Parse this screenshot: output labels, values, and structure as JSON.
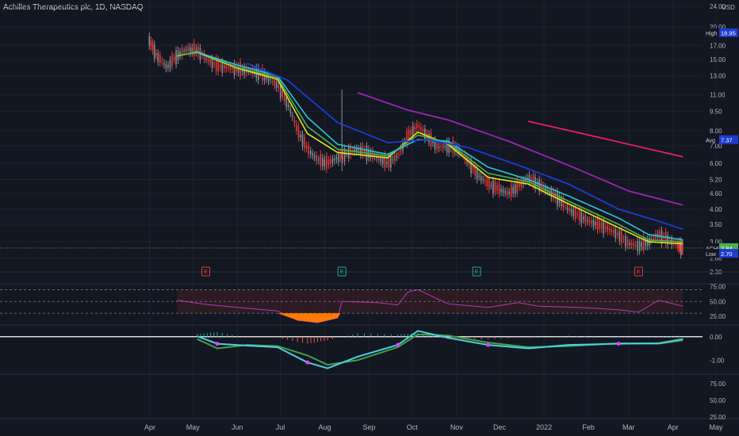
{
  "header": {
    "title": "Achilles Therapeutics plc, 1D, NASDAQ"
  },
  "colors": {
    "background": "#131722",
    "grid": "#1e222d",
    "up_candle": "#8a8d96",
    "down_candle": "#e53935",
    "ema_yellow": "#e6e619",
    "ema_green": "#4caf50",
    "ema_cyan": "#26c6da",
    "ema_blue": "#1e3cd0",
    "ema_purple": "#9c27b0",
    "ema_pink": "#e91e63",
    "rsi_line": "#b03ab5",
    "macd_line": "#4dd0e1",
    "signal_line": "#43a047"
  },
  "chart_data": {
    "type": "candlestick",
    "title": "Achilles Therapeutics plc, 1D, NASDAQ",
    "currency": "USD",
    "scale": "log",
    "grid": true,
    "x_ticks": [
      "Apr",
      "May",
      "Jun",
      "Jul",
      "Aug",
      "Sep",
      "Oct",
      "Nov",
      "Dec",
      "2022",
      "Feb",
      "Mar",
      "Apr",
      "May"
    ],
    "y_ticks": [
      "24.00",
      "20.00",
      "17.00",
      "15.00",
      "13.00",
      "11.00",
      "9.50",
      "8.00",
      "7.00",
      "6.00",
      "5.20",
      "4.60",
      "4.00",
      "3.50",
      "3.00",
      "2.60",
      "2.30"
    ],
    "ylim": [
      2.3,
      24.0
    ],
    "price_closes": [
      {
        "date": "2021-03-31",
        "close": 18.0
      },
      {
        "date": "2021-04-06",
        "close": 15.5
      },
      {
        "date": "2021-04-13",
        "close": 14.0
      },
      {
        "date": "2021-04-20",
        "close": 15.6
      },
      {
        "date": "2021-04-27",
        "close": 16.4
      },
      {
        "date": "2021-05-04",
        "close": 16.3
      },
      {
        "date": "2021-05-11",
        "close": 15.0
      },
      {
        "date": "2021-05-18",
        "close": 14.2
      },
      {
        "date": "2021-05-25",
        "close": 14.0
      },
      {
        "date": "2021-06-01",
        "close": 13.8
      },
      {
        "date": "2021-06-08",
        "close": 13.6
      },
      {
        "date": "2021-06-15",
        "close": 13.4
      },
      {
        "date": "2021-06-22",
        "close": 12.8
      },
      {
        "date": "2021-06-29",
        "close": 12.0
      },
      {
        "date": "2021-07-06",
        "close": 10.2
      },
      {
        "date": "2021-07-13",
        "close": 8.0
      },
      {
        "date": "2021-07-20",
        "close": 6.8
      },
      {
        "date": "2021-07-27",
        "close": 6.2
      },
      {
        "date": "2021-08-03",
        "close": 6.0
      },
      {
        "date": "2021-08-10",
        "close": 6.3
      },
      {
        "date": "2021-08-17",
        "close": 6.6
      },
      {
        "date": "2021-08-24",
        "close": 6.8
      },
      {
        "date": "2021-08-31",
        "close": 6.6
      },
      {
        "date": "2021-09-07",
        "close": 6.3
      },
      {
        "date": "2021-09-14",
        "close": 6.0
      },
      {
        "date": "2021-09-21",
        "close": 6.4
      },
      {
        "date": "2021-09-28",
        "close": 7.6
      },
      {
        "date": "2021-10-05",
        "close": 8.4
      },
      {
        "date": "2021-10-12",
        "close": 7.6
      },
      {
        "date": "2021-10-19",
        "close": 6.9
      },
      {
        "date": "2021-10-26",
        "close": 7.0
      },
      {
        "date": "2021-11-02",
        "close": 6.8
      },
      {
        "date": "2021-11-09",
        "close": 6.1
      },
      {
        "date": "2021-11-16",
        "close": 5.4
      },
      {
        "date": "2021-11-23",
        "close": 5.0
      },
      {
        "date": "2021-11-30",
        "close": 4.8
      },
      {
        "date": "2021-12-07",
        "close": 4.6
      },
      {
        "date": "2021-12-14",
        "close": 4.9
      },
      {
        "date": "2021-12-21",
        "close": 5.3
      },
      {
        "date": "2021-12-28",
        "close": 5.0
      },
      {
        "date": "2022-01-04",
        "close": 4.7
      },
      {
        "date": "2022-01-11",
        "close": 4.4
      },
      {
        "date": "2022-01-18",
        "close": 4.0
      },
      {
        "date": "2022-01-25",
        "close": 3.8
      },
      {
        "date": "2022-02-01",
        "close": 3.6
      },
      {
        "date": "2022-02-08",
        "close": 3.5
      },
      {
        "date": "2022-02-15",
        "close": 3.35
      },
      {
        "date": "2022-02-22",
        "close": 3.2
      },
      {
        "date": "2022-03-01",
        "close": 2.95
      },
      {
        "date": "2022-03-08",
        "close": 2.9
      },
      {
        "date": "2022-03-15",
        "close": 3.0
      },
      {
        "date": "2022-03-22",
        "close": 3.2
      },
      {
        "date": "2022-03-29",
        "close": 3.05
      },
      {
        "date": "2022-04-05",
        "close": 2.9
      },
      {
        "date": "2022-04-08",
        "close": 2.84
      }
    ],
    "moving_averages": [
      {
        "color": "#e6e619",
        "values": [
          {
            "date": "2021-04-20",
            "v": 15.5
          },
          {
            "date": "2021-05-04",
            "v": 16.0
          },
          {
            "date": "2021-06-01",
            "v": 13.9
          },
          {
            "date": "2021-06-29",
            "v": 12.6
          },
          {
            "date": "2021-07-20",
            "v": 7.8
          },
          {
            "date": "2021-08-10",
            "v": 6.6
          },
          {
            "date": "2021-09-14",
            "v": 6.3
          },
          {
            "date": "2021-10-05",
            "v": 7.9
          },
          {
            "date": "2021-10-26",
            "v": 7.1
          },
          {
            "date": "2021-11-23",
            "v": 5.3
          },
          {
            "date": "2021-12-21",
            "v": 5.0
          },
          {
            "date": "2022-01-18",
            "v": 4.2
          },
          {
            "date": "2022-02-22",
            "v": 3.4
          },
          {
            "date": "2022-03-15",
            "v": 3.0
          },
          {
            "date": "2022-04-08",
            "v": 2.95
          }
        ]
      },
      {
        "color": "#4caf50",
        "values": [
          {
            "date": "2021-04-20",
            "v": 15.4
          },
          {
            "date": "2021-05-04",
            "v": 16.1
          },
          {
            "date": "2021-06-01",
            "v": 14.0
          },
          {
            "date": "2021-06-29",
            "v": 12.8
          },
          {
            "date": "2021-07-20",
            "v": 8.3
          },
          {
            "date": "2021-08-10",
            "v": 6.8
          },
          {
            "date": "2021-09-14",
            "v": 6.4
          },
          {
            "date": "2021-10-05",
            "v": 7.7
          },
          {
            "date": "2021-10-26",
            "v": 7.2
          },
          {
            "date": "2021-11-23",
            "v": 5.5
          },
          {
            "date": "2021-12-21",
            "v": 5.1
          },
          {
            "date": "2022-01-18",
            "v": 4.3
          },
          {
            "date": "2022-02-22",
            "v": 3.5
          },
          {
            "date": "2022-03-15",
            "v": 3.05
          },
          {
            "date": "2022-04-08",
            "v": 3.0
          }
        ]
      },
      {
        "color": "#26c6da",
        "values": [
          {
            "date": "2021-05-04",
            "v": 16.0
          },
          {
            "date": "2021-06-01",
            "v": 14.3
          },
          {
            "date": "2021-06-29",
            "v": 13.0
          },
          {
            "date": "2021-07-20",
            "v": 9.0
          },
          {
            "date": "2021-08-10",
            "v": 7.1
          },
          {
            "date": "2021-09-14",
            "v": 6.5
          },
          {
            "date": "2021-10-05",
            "v": 7.4
          },
          {
            "date": "2021-10-26",
            "v": 7.3
          },
          {
            "date": "2021-11-23",
            "v": 5.8
          },
          {
            "date": "2021-12-21",
            "v": 5.2
          },
          {
            "date": "2022-01-18",
            "v": 4.5
          },
          {
            "date": "2022-02-22",
            "v": 3.7
          },
          {
            "date": "2022-03-15",
            "v": 3.2
          },
          {
            "date": "2022-04-08",
            "v": 3.05
          }
        ]
      },
      {
        "color": "#1e3cd0",
        "values": [
          {
            "date": "2021-06-08",
            "v": 14.5
          },
          {
            "date": "2021-07-06",
            "v": 12.5
          },
          {
            "date": "2021-08-10",
            "v": 8.6
          },
          {
            "date": "2021-09-14",
            "v": 7.2
          },
          {
            "date": "2021-10-12",
            "v": 7.4
          },
          {
            "date": "2021-11-09",
            "v": 6.9
          },
          {
            "date": "2021-12-14",
            "v": 5.9
          },
          {
            "date": "2022-01-18",
            "v": 5.0
          },
          {
            "date": "2022-02-22",
            "v": 4.0
          },
          {
            "date": "2022-03-22",
            "v": 3.6
          },
          {
            "date": "2022-04-08",
            "v": 3.35
          }
        ]
      },
      {
        "color": "#9c27b0",
        "values": [
          {
            "date": "2021-08-24",
            "v": 11.2
          },
          {
            "date": "2021-09-28",
            "v": 9.6
          },
          {
            "date": "2021-10-26",
            "v": 8.8
          },
          {
            "date": "2021-12-07",
            "v": 7.3
          },
          {
            "date": "2022-01-18",
            "v": 5.9
          },
          {
            "date": "2022-03-01",
            "v": 4.7
          },
          {
            "date": "2022-04-08",
            "v": 4.15
          }
        ]
      },
      {
        "color": "#e91e63",
        "values": [
          {
            "date": "2021-12-21",
            "v": 8.7
          },
          {
            "date": "2022-02-15",
            "v": 7.4
          },
          {
            "date": "2022-04-08",
            "v": 6.35
          }
        ]
      }
    ],
    "price_labels": [
      {
        "label": "High",
        "value": "18.95",
        "color": "#1e3cd0"
      },
      {
        "label": "Avg",
        "value": "7.37",
        "color": "#1e3cd0"
      },
      {
        "label": "ACHL",
        "value": "2.84",
        "color": "#4caf50"
      },
      {
        "label": "Low",
        "value": "2.70",
        "color": "#1e3cd0"
      }
    ],
    "earnings_markers": [
      {
        "date": "2021-05-10",
        "label": "E",
        "color": "#e53935"
      },
      {
        "date": "2021-08-13",
        "label": "E",
        "color": "#26a69a"
      },
      {
        "date": "2021-11-15",
        "label": "E",
        "color": "#26a69a"
      },
      {
        "date": "2022-03-08",
        "label": "E",
        "color": "#e53935"
      }
    ],
    "rsi": {
      "ticks": [
        "75.00",
        "50.00",
        "25.00"
      ],
      "upper": 70,
      "lower": 30,
      "values": [
        {
          "date": "2021-04-20",
          "v": 52
        },
        {
          "date": "2021-05-10",
          "v": 45
        },
        {
          "date": "2021-06-01",
          "v": 40
        },
        {
          "date": "2021-06-29",
          "v": 34
        },
        {
          "date": "2021-07-13",
          "v": 18
        },
        {
          "date": "2021-07-27",
          "v": 14
        },
        {
          "date": "2021-08-10",
          "v": 22
        },
        {
          "date": "2021-08-13",
          "v": 50
        },
        {
          "date": "2021-09-07",
          "v": 48
        },
        {
          "date": "2021-09-21",
          "v": 44
        },
        {
          "date": "2021-09-28",
          "v": 66
        },
        {
          "date": "2021-10-05",
          "v": 70
        },
        {
          "date": "2021-10-26",
          "v": 46
        },
        {
          "date": "2021-11-23",
          "v": 40
        },
        {
          "date": "2021-12-14",
          "v": 48
        },
        {
          "date": "2021-12-28",
          "v": 42
        },
        {
          "date": "2022-01-25",
          "v": 40
        },
        {
          "date": "2022-02-22",
          "v": 36
        },
        {
          "date": "2022-03-08",
          "v": 32
        },
        {
          "date": "2022-03-22",
          "v": 52
        },
        {
          "date": "2022-04-08",
          "v": 42
        }
      ]
    },
    "macd": {
      "ticks": [
        "0.00",
        "-1.00"
      ],
      "macd": [
        {
          "date": "2021-05-04",
          "v": 0.02
        },
        {
          "date": "2021-05-18",
          "v": -0.3
        },
        {
          "date": "2021-06-08",
          "v": -0.38
        },
        {
          "date": "2021-06-29",
          "v": -0.45
        },
        {
          "date": "2021-07-20",
          "v": -1.1
        },
        {
          "date": "2021-08-03",
          "v": -1.35
        },
        {
          "date": "2021-08-24",
          "v": -0.85
        },
        {
          "date": "2021-09-21",
          "v": -0.35
        },
        {
          "date": "2021-10-05",
          "v": 0.25
        },
        {
          "date": "2021-10-26",
          "v": -0.05
        },
        {
          "date": "2021-11-23",
          "v": -0.35
        },
        {
          "date": "2021-12-21",
          "v": -0.5
        },
        {
          "date": "2022-01-18",
          "v": -0.35
        },
        {
          "date": "2022-02-22",
          "v": -0.3
        },
        {
          "date": "2022-03-22",
          "v": -0.28
        },
        {
          "date": "2022-04-08",
          "v": -0.1
        }
      ],
      "signal": [
        {
          "date": "2021-05-04",
          "v": -0.1
        },
        {
          "date": "2021-05-18",
          "v": -0.5
        },
        {
          "date": "2021-06-08",
          "v": -0.35
        },
        {
          "date": "2021-06-29",
          "v": -0.4
        },
        {
          "date": "2021-07-20",
          "v": -0.8
        },
        {
          "date": "2021-08-03",
          "v": -1.2
        },
        {
          "date": "2021-08-24",
          "v": -1.0
        },
        {
          "date": "2021-09-21",
          "v": -0.45
        },
        {
          "date": "2021-10-05",
          "v": 0.1
        },
        {
          "date": "2021-10-26",
          "v": 0.05
        },
        {
          "date": "2021-11-23",
          "v": -0.25
        },
        {
          "date": "2021-12-21",
          "v": -0.45
        },
        {
          "date": "2022-01-18",
          "v": -0.4
        },
        {
          "date": "2022-02-22",
          "v": -0.28
        },
        {
          "date": "2022-03-22",
          "v": -0.3
        },
        {
          "date": "2022-04-08",
          "v": -0.15
        }
      ]
    },
    "bottom_pane": {
      "ticks": [
        "75.00",
        "50.00",
        "25.00"
      ]
    }
  }
}
